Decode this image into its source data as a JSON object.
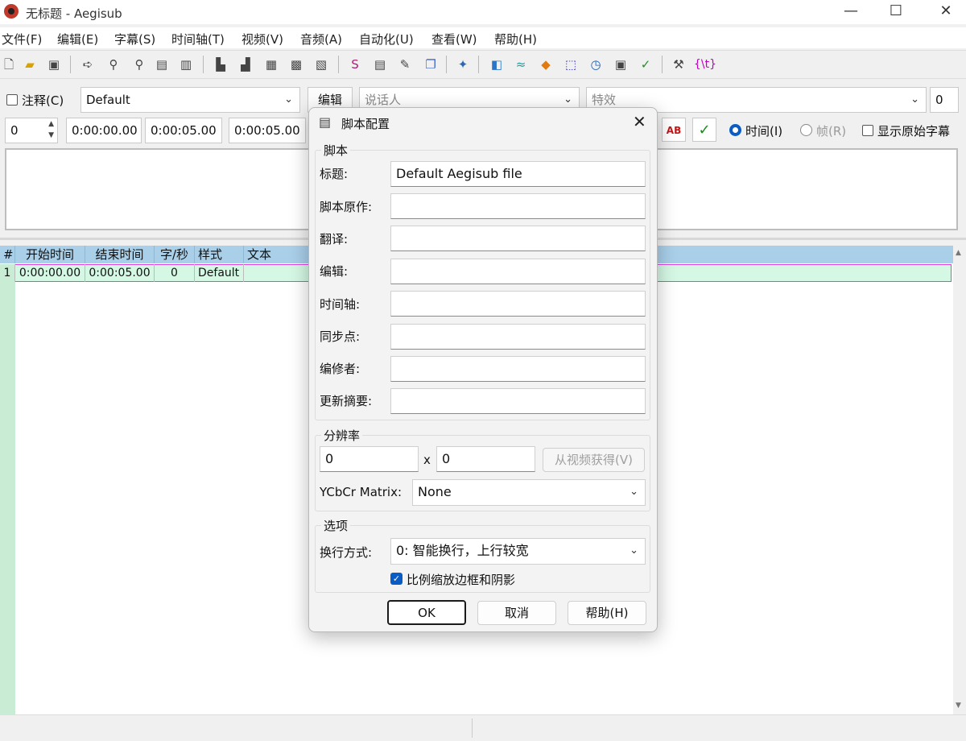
{
  "window": {
    "title": "无标题 - Aegisub",
    "minimize": "—",
    "maximize": "☐",
    "close": "✕"
  },
  "menu": [
    "文件(F)",
    "编辑(E)",
    "字幕(S)",
    "时间轴(T)",
    "视频(V)",
    "音频(A)",
    "自动化(U)",
    "查看(W)",
    "帮助(H)"
  ],
  "toolbar_icons": [
    "new-file",
    "open-file",
    "save-file",
    "jump-to",
    "zoom-in",
    "zoom-out",
    "video-props",
    "video-detail",
    "save-frame",
    "copy-frame",
    "video-to-subtitle",
    "snapshot",
    "keyframes",
    "styles-manager",
    "properties",
    "attachments",
    "fonts-collector",
    "automation",
    "shift-times",
    "timing-postprocessor",
    "kanji-timer",
    "resample",
    "timer",
    "translation-assistant",
    "spell-check",
    "options",
    "tag-toggle"
  ],
  "edit": {
    "comment_label": "注释(C)",
    "style_value": "Default",
    "edit_button": "编辑",
    "actor_placeholder": "说话人",
    "effect_placeholder": "特效",
    "margin_value": "0",
    "layer_value": "0",
    "start_time": "0:00:00.00",
    "end_time": "0:00:05.00",
    "duration": "0:00:05.00",
    "ab_label": "AB",
    "commit_label": "✓",
    "radio_time": "时间(I)",
    "radio_frame": "帧(R)",
    "show_original": "显示原始字幕"
  },
  "grid": {
    "headers": [
      "#",
      "开始时间",
      "结束时间",
      "字/秒",
      "样式",
      "文本"
    ],
    "rows": [
      {
        "n": "1",
        "start": "0:00:00.00",
        "end": "0:00:05.00",
        "cps": "0",
        "style": "Default",
        "text": ""
      }
    ]
  },
  "dialog": {
    "title": "脚本配置",
    "close": "✕",
    "script_group": "脚本",
    "fields": [
      {
        "label": "标题:",
        "value": "Default Aegisub file"
      },
      {
        "label": "脚本原作:",
        "value": ""
      },
      {
        "label": "翻译:",
        "value": ""
      },
      {
        "label": "编辑:",
        "value": ""
      },
      {
        "label": "时间轴:",
        "value": ""
      },
      {
        "label": "同步点:",
        "value": ""
      },
      {
        "label": "编修者:",
        "value": ""
      },
      {
        "label": "更新摘要:",
        "value": ""
      }
    ],
    "resolution_group": "分辨率",
    "res_x": "0",
    "res_x_sep": "x",
    "res_y": "0",
    "from_video": "从视频获得(V)",
    "ycbcr_label": "YCbCr Matrix:",
    "ycbcr_value": "None",
    "options_group": "选项",
    "wrap_label": "换行方式:",
    "wrap_value": "0: 智能换行，上行较宽",
    "scale_border": "比例缩放边框和阴影",
    "scale_border_checked": true,
    "ok": "OK",
    "cancel": "取消",
    "help": "帮助(H)"
  },
  "colors": {
    "grid_header": "#a9cfe9",
    "row_active": "#d4f8e4",
    "row_border": "#e040e0",
    "accent": "#0a5bc4"
  }
}
